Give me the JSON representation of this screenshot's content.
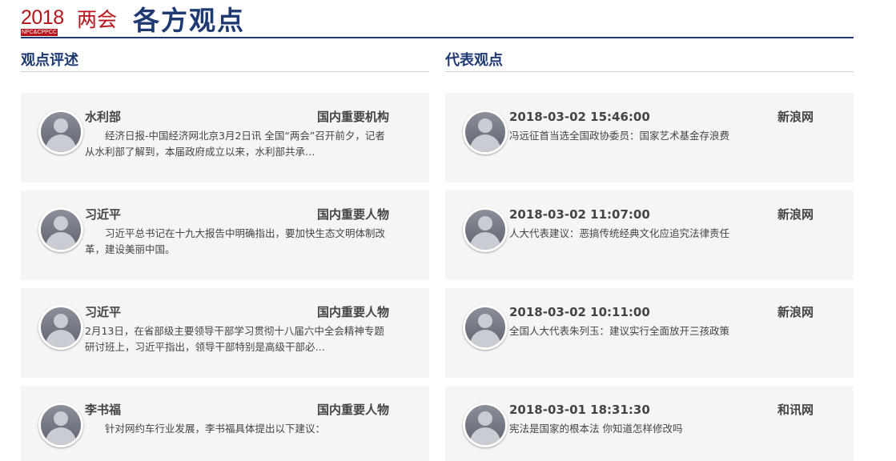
{
  "header": {
    "logo_year": "2018",
    "logo_sub": "NPC&CPPCC",
    "logo_lianghui": "两会",
    "title": "各方观点"
  },
  "left": {
    "title": "观点评述",
    "items": [
      {
        "name": "水利部",
        "category": "国内重要机构",
        "text": "　　经济日报-中国经济网北京3月2日讯 全国“两会”召开前夕，记者从水利部了解到，本届政府成立以来，水利部共承…"
      },
      {
        "name": "习近平",
        "category": "国内重要人物",
        "text": "　　习近平总书记在十九大报告中明确指出，要加快生态文明体制改革，建设美丽中国。"
      },
      {
        "name": "习近平",
        "category": "国内重要人物",
        "text": "2月13日，在省部级主要领导干部学习贯彻十八届六中全会精神专题研讨班上，习近平指出，领导干部特别是高级干部必…"
      },
      {
        "name": "李书福",
        "category": "国内重要人物",
        "text": "　　针对网约车行业发展，李书福具体提出以下建议："
      }
    ]
  },
  "right": {
    "title": "代表观点",
    "items": [
      {
        "time": "2018-03-02 15:46:00",
        "source": "新浪网",
        "headline": "冯远征首当选全国政协委员：国家艺术基金存浪费"
      },
      {
        "time": "2018-03-02 11:07:00",
        "source": "新浪网",
        "headline": "人大代表建议：恶搞传统经典文化应追究法律责任"
      },
      {
        "time": "2018-03-02 10:11:00",
        "source": "新浪网",
        "headline": "全国人大代表朱列玉：建议实行全面放开三孩政策"
      },
      {
        "time": "2018-03-01 18:31:30",
        "source": "和讯网",
        "headline": "宪法是国家的根本法 你知道怎样修改吗"
      }
    ]
  },
  "colors": {
    "brand_red": "#b4141a",
    "navy": "#1f3a73",
    "card_bg": "#f5f5f5"
  }
}
